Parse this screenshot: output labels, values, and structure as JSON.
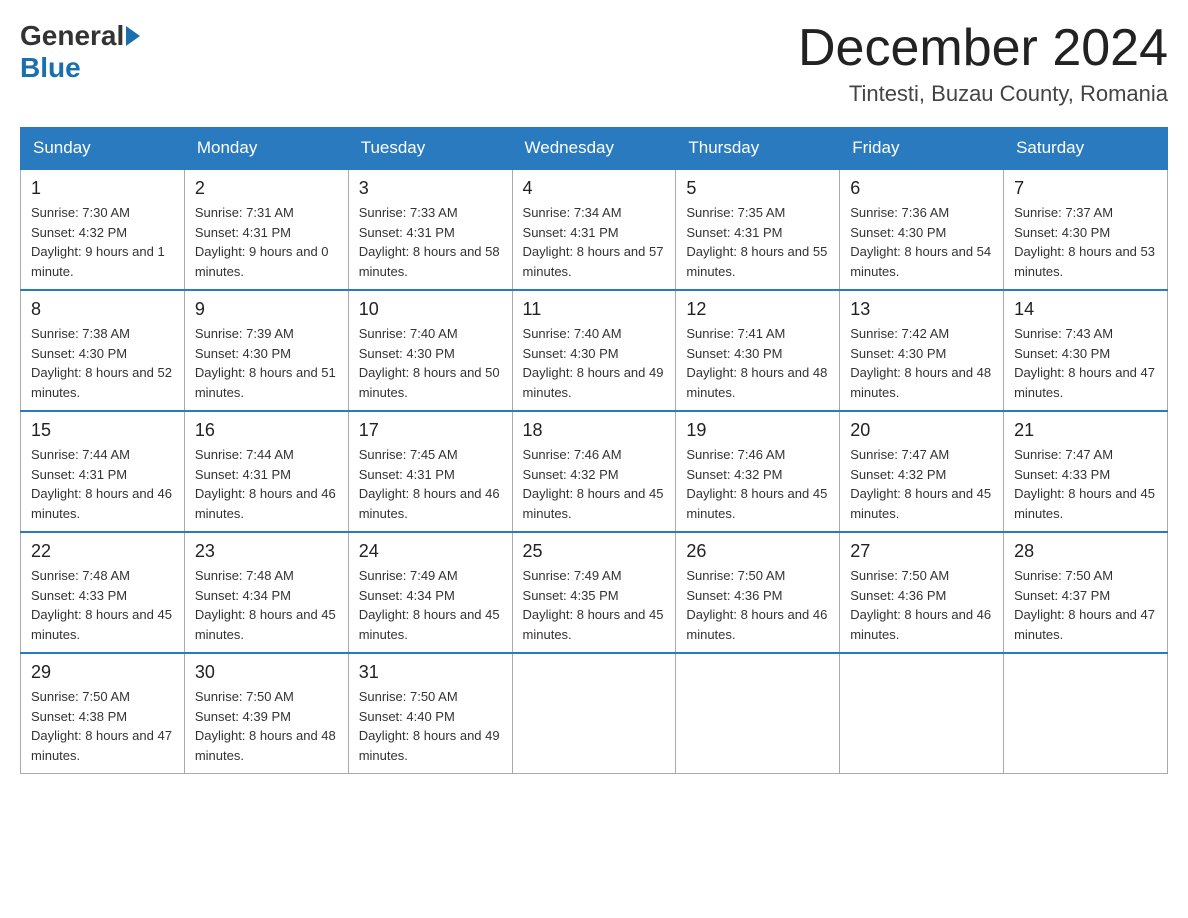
{
  "header": {
    "logo": {
      "general": "General",
      "blue": "Blue"
    },
    "title": "December 2024",
    "location": "Tintesti, Buzau County, Romania"
  },
  "days_of_week": [
    "Sunday",
    "Monday",
    "Tuesday",
    "Wednesday",
    "Thursday",
    "Friday",
    "Saturday"
  ],
  "weeks": [
    [
      {
        "day": "1",
        "sunrise": "7:30 AM",
        "sunset": "4:32 PM",
        "daylight": "9 hours and 1 minute."
      },
      {
        "day": "2",
        "sunrise": "7:31 AM",
        "sunset": "4:31 PM",
        "daylight": "9 hours and 0 minutes."
      },
      {
        "day": "3",
        "sunrise": "7:33 AM",
        "sunset": "4:31 PM",
        "daylight": "8 hours and 58 minutes."
      },
      {
        "day": "4",
        "sunrise": "7:34 AM",
        "sunset": "4:31 PM",
        "daylight": "8 hours and 57 minutes."
      },
      {
        "day": "5",
        "sunrise": "7:35 AM",
        "sunset": "4:31 PM",
        "daylight": "8 hours and 55 minutes."
      },
      {
        "day": "6",
        "sunrise": "7:36 AM",
        "sunset": "4:30 PM",
        "daylight": "8 hours and 54 minutes."
      },
      {
        "day": "7",
        "sunrise": "7:37 AM",
        "sunset": "4:30 PM",
        "daylight": "8 hours and 53 minutes."
      }
    ],
    [
      {
        "day": "8",
        "sunrise": "7:38 AM",
        "sunset": "4:30 PM",
        "daylight": "8 hours and 52 minutes."
      },
      {
        "day": "9",
        "sunrise": "7:39 AM",
        "sunset": "4:30 PM",
        "daylight": "8 hours and 51 minutes."
      },
      {
        "day": "10",
        "sunrise": "7:40 AM",
        "sunset": "4:30 PM",
        "daylight": "8 hours and 50 minutes."
      },
      {
        "day": "11",
        "sunrise": "7:40 AM",
        "sunset": "4:30 PM",
        "daylight": "8 hours and 49 minutes."
      },
      {
        "day": "12",
        "sunrise": "7:41 AM",
        "sunset": "4:30 PM",
        "daylight": "8 hours and 48 minutes."
      },
      {
        "day": "13",
        "sunrise": "7:42 AM",
        "sunset": "4:30 PM",
        "daylight": "8 hours and 48 minutes."
      },
      {
        "day": "14",
        "sunrise": "7:43 AM",
        "sunset": "4:30 PM",
        "daylight": "8 hours and 47 minutes."
      }
    ],
    [
      {
        "day": "15",
        "sunrise": "7:44 AM",
        "sunset": "4:31 PM",
        "daylight": "8 hours and 46 minutes."
      },
      {
        "day": "16",
        "sunrise": "7:44 AM",
        "sunset": "4:31 PM",
        "daylight": "8 hours and 46 minutes."
      },
      {
        "day": "17",
        "sunrise": "7:45 AM",
        "sunset": "4:31 PM",
        "daylight": "8 hours and 46 minutes."
      },
      {
        "day": "18",
        "sunrise": "7:46 AM",
        "sunset": "4:32 PM",
        "daylight": "8 hours and 45 minutes."
      },
      {
        "day": "19",
        "sunrise": "7:46 AM",
        "sunset": "4:32 PM",
        "daylight": "8 hours and 45 minutes."
      },
      {
        "day": "20",
        "sunrise": "7:47 AM",
        "sunset": "4:32 PM",
        "daylight": "8 hours and 45 minutes."
      },
      {
        "day": "21",
        "sunrise": "7:47 AM",
        "sunset": "4:33 PM",
        "daylight": "8 hours and 45 minutes."
      }
    ],
    [
      {
        "day": "22",
        "sunrise": "7:48 AM",
        "sunset": "4:33 PM",
        "daylight": "8 hours and 45 minutes."
      },
      {
        "day": "23",
        "sunrise": "7:48 AM",
        "sunset": "4:34 PM",
        "daylight": "8 hours and 45 minutes."
      },
      {
        "day": "24",
        "sunrise": "7:49 AM",
        "sunset": "4:34 PM",
        "daylight": "8 hours and 45 minutes."
      },
      {
        "day": "25",
        "sunrise": "7:49 AM",
        "sunset": "4:35 PM",
        "daylight": "8 hours and 45 minutes."
      },
      {
        "day": "26",
        "sunrise": "7:50 AM",
        "sunset": "4:36 PM",
        "daylight": "8 hours and 46 minutes."
      },
      {
        "day": "27",
        "sunrise": "7:50 AM",
        "sunset": "4:36 PM",
        "daylight": "8 hours and 46 minutes."
      },
      {
        "day": "28",
        "sunrise": "7:50 AM",
        "sunset": "4:37 PM",
        "daylight": "8 hours and 47 minutes."
      }
    ],
    [
      {
        "day": "29",
        "sunrise": "7:50 AM",
        "sunset": "4:38 PM",
        "daylight": "8 hours and 47 minutes."
      },
      {
        "day": "30",
        "sunrise": "7:50 AM",
        "sunset": "4:39 PM",
        "daylight": "8 hours and 48 minutes."
      },
      {
        "day": "31",
        "sunrise": "7:50 AM",
        "sunset": "4:40 PM",
        "daylight": "8 hours and 49 minutes."
      },
      null,
      null,
      null,
      null
    ]
  ],
  "labels": {
    "sunrise": "Sunrise:",
    "sunset": "Sunset:",
    "daylight": "Daylight:"
  }
}
